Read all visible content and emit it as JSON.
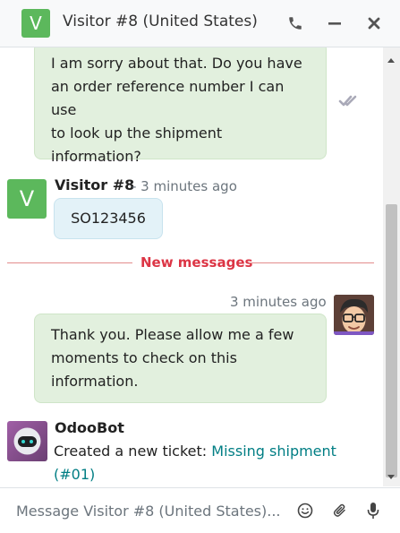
{
  "header": {
    "avatar_letter": "V",
    "title": "Visitor #8 (United States)",
    "icons": [
      "phone-icon",
      "minimize-icon",
      "close-icon"
    ]
  },
  "messages": {
    "m1": {
      "lines": [
        "I am sorry about that. Do you have",
        "an order reference number I can use",
        "to look up the shipment",
        "information?"
      ],
      "status_icon": "double-check-icon"
    },
    "m2": {
      "avatar_letter": "V",
      "author": "Visitor #8",
      "time": "- 3 minutes ago",
      "text": "SO123456"
    },
    "separator": "New messages",
    "m3": {
      "time": "3 minutes ago",
      "lines": [
        "Thank you. Please allow me a few",
        "moments to check on this",
        "information."
      ]
    },
    "m4": {
      "author": "OdooBot",
      "text_prefix": "Created a new ticket: ",
      "link_line1": "Missing shipment",
      "link_line2": "(#01)"
    }
  },
  "composer": {
    "placeholder": "Message Visitor #8 (United States)...",
    "icons": [
      "emoji-icon",
      "paperclip-icon",
      "microphone-icon"
    ]
  },
  "colors": {
    "visitor_avatar": "#5cb85c",
    "bubble_green": "#e2f0de",
    "bubble_blue": "#e3f2f8",
    "new_messages": "#dc3545",
    "link": "#017e84"
  }
}
